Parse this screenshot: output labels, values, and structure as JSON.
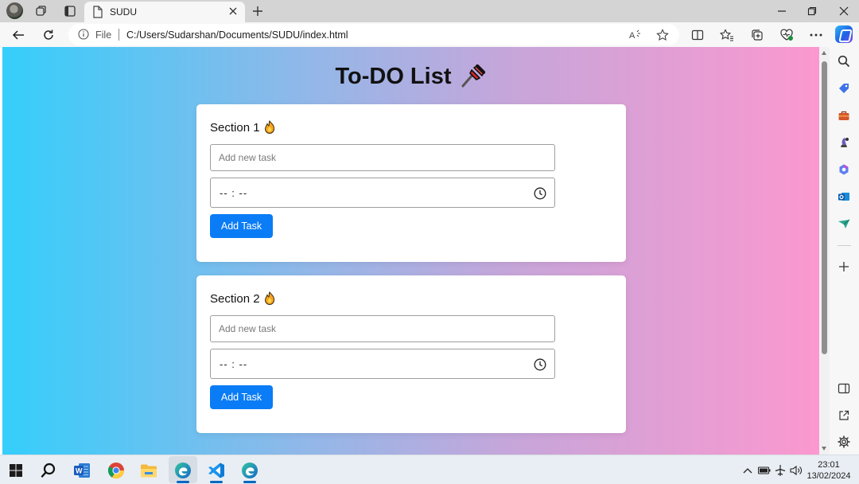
{
  "browser": {
    "tab": {
      "title": "SUDU"
    },
    "address": {
      "scheme_label": "File",
      "url": "C:/Users/Sudarshan/Documents/SUDU/index.html"
    }
  },
  "page": {
    "title": "To-DO List",
    "sections": [
      {
        "title": "Section 1",
        "task_placeholder": "Add new task",
        "time_value": "-- : --",
        "button_label": "Add Task"
      },
      {
        "title": "Section 2",
        "task_placeholder": "Add new task",
        "time_value": "-- : --",
        "button_label": "Add Task"
      }
    ],
    "emoji": {
      "title": "pushpin",
      "section": "fire"
    },
    "colors": {
      "gradient_start": "#35cefb",
      "gradient_end": "#fb98cf",
      "button": "#0a7cf6"
    }
  },
  "taskbar": {
    "apps": [
      "start-icon",
      "search-icon",
      "word-icon",
      "chrome-icon",
      "file-explorer-icon",
      "edge-icon",
      "vscode-icon",
      "edge-icon"
    ],
    "clock": {
      "time": "23:01",
      "date": "13/02/2024"
    }
  }
}
